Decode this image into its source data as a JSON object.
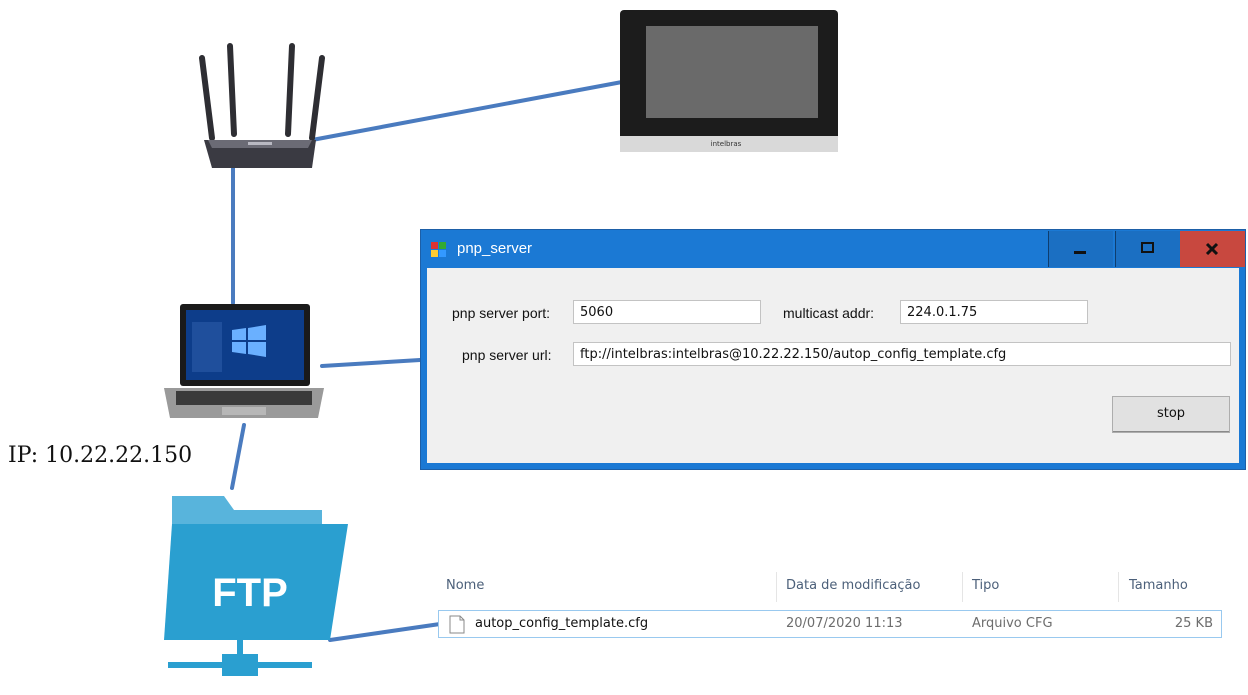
{
  "diagram": {
    "ip_label": "IP: 10.22.22.150",
    "ftp_label": "FTP",
    "monitor_brand": "intelbras",
    "link_color": "#4a7bbf"
  },
  "window": {
    "title": "pnp_server",
    "titlebar_color": "#1b79d4",
    "close_color": "#c8483f",
    "port_label": "pnp server port:",
    "port_value": "5060",
    "multicast_label": "multicast addr:",
    "multicast_value": "224.0.1.75",
    "url_label": "pnp server url:",
    "url_value": "ftp://intelbras:intelbras@10.22.22.150/autop_config_template.cfg",
    "stop_label": "stop",
    "minimize_icon": "minimize-icon",
    "maximize_icon": "maximize-icon",
    "close_icon": "close-icon"
  },
  "file_list": {
    "columns": {
      "name": "Nome",
      "date": "Data de modificação",
      "type": "Tipo",
      "size": "Tamanho"
    },
    "rows": [
      {
        "name": "autop_config_template.cfg",
        "date": "20/07/2020 11:13",
        "type": "Arquivo CFG",
        "size": "25 KB"
      }
    ]
  }
}
